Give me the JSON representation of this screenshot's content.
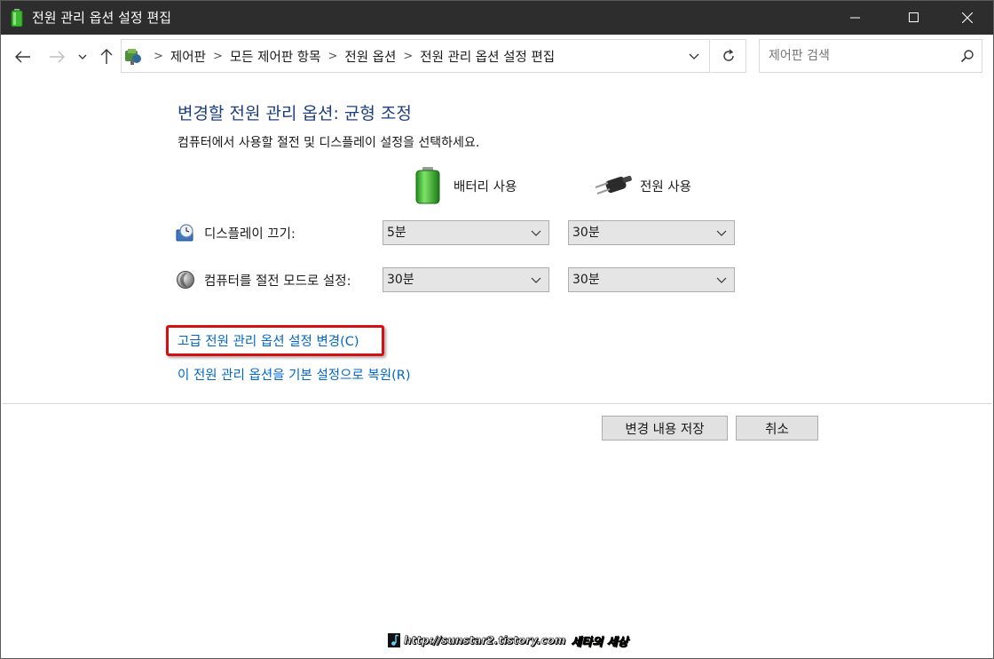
{
  "window": {
    "title": "전원 관리 옵션 설정 편집"
  },
  "address": {
    "breadcrumbs": [
      "제어판",
      "모든 제어판 항목",
      "전원 옵션",
      "전원 관리 옵션 설정 편집"
    ],
    "separator": ">"
  },
  "search": {
    "placeholder": "제어판 검색"
  },
  "content": {
    "heading": "변경할 전원 관리 옵션: 균형 조정",
    "description": "컴퓨터에서 사용할 절전 및 디스플레이 설정을 선택하세요.",
    "columns": {
      "battery": "배터리 사용",
      "plugged_in": "전원 사용"
    },
    "rows": {
      "display_off": {
        "label": "디스플레이 끄기:",
        "battery_value": "5분",
        "plugged_value": "30분"
      },
      "sleep": {
        "label": "컴퓨터를 절전 모드로 설정:",
        "battery_value": "30분",
        "plugged_value": "30분"
      }
    },
    "links": {
      "advanced": "고급 전원 관리 옵션 설정 변경(C)",
      "restore": "이 전원 관리 옵션을 기본 설정으로 복원(R)"
    },
    "buttons": {
      "save": "변경 내용 저장",
      "cancel": "취소"
    }
  },
  "watermark": {
    "url": "http://sunstar2.tistory.com",
    "name": "세타의 세상"
  },
  "colors": {
    "titlebar": "#2d2d2d",
    "heading": "#1e3e82",
    "link": "#0066cc",
    "highlight_border": "#d51010"
  }
}
